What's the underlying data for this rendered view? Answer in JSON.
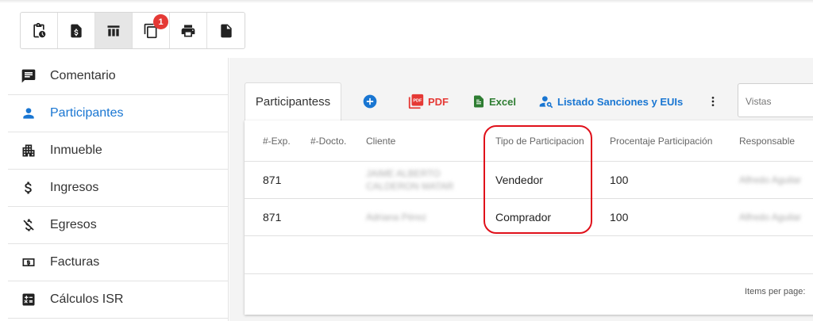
{
  "toolbar": {
    "icons": [
      "clipboard-clock-icon",
      "invoice-dollar-icon",
      "table-columns-icon",
      "copy-icon",
      "print-icon",
      "document-icon"
    ],
    "badge_count": "1"
  },
  "sidebar": {
    "items": [
      {
        "label": "Comentario",
        "icon": "comment-icon"
      },
      {
        "label": "Participantes",
        "icon": "person-icon"
      },
      {
        "label": "Inmueble",
        "icon": "building-icon"
      },
      {
        "label": "Ingresos",
        "icon": "dollar-icon"
      },
      {
        "label": "Egresos",
        "icon": "dollar-off-icon"
      },
      {
        "label": "Facturas",
        "icon": "bill-icon"
      },
      {
        "label": "Cálculos ISR",
        "icon": "calculator-icon"
      }
    ]
  },
  "tab": {
    "label": "Participantess"
  },
  "actions": {
    "pdf": "PDF",
    "excel": "Excel",
    "listado": "Listado Sanciones y EUIs"
  },
  "vistas": {
    "placeholder": "Vistas"
  },
  "table": {
    "headers": [
      "#-Exp.",
      "#-Docto.",
      "Cliente",
      "Tipo de Participacion",
      "Procentaje Participación",
      "Responsable"
    ],
    "rows": [
      {
        "exp": "871",
        "docto": "",
        "cliente": "JAIME ALBERTO CALDERON MATAR",
        "tipo": "Vendedor",
        "porcentaje": "100",
        "responsable": "Alfredo Aguilar"
      },
      {
        "exp": "871",
        "docto": "",
        "cliente": "Adriana Pérez",
        "tipo": "Comprador",
        "porcentaje": "100",
        "responsable": "Alfredo Aguilar"
      }
    ],
    "items_per_page_label": "Items per page:"
  },
  "colors": {
    "accent": "#1976d2",
    "pdf": "#e53935",
    "excel": "#2e7d32",
    "highlight": "#e0101a"
  }
}
